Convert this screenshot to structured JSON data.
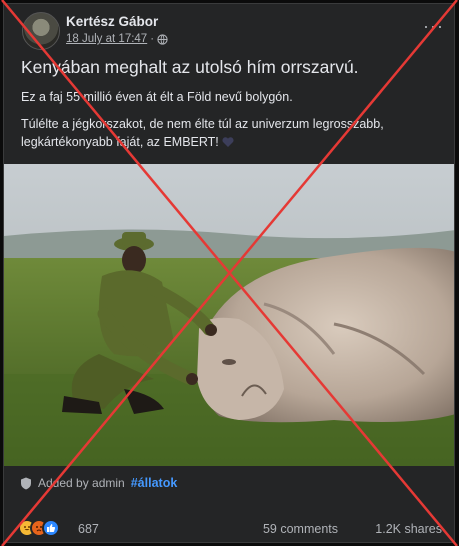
{
  "post": {
    "author": "Kertész Gábor",
    "date": "18 July at 17:47",
    "separator": "·",
    "headline": "Kenyában meghalt az utolsó hím orrszarvú.",
    "paragraph1": "Ez a faj 55 millió éven át élt a Föld nevű bolygón.",
    "paragraph2": "Túlélte a jégkorszakot, de nem élte túl az univerzum legrosszabb, legkártékonyabb faját, az EMBERT!",
    "image_icon": "black-heart-emoji"
  },
  "footer": {
    "added_by": "Added by admin",
    "tag": "#állatok"
  },
  "stats": {
    "reaction_count": "687",
    "comments": "59 comments",
    "shares": "1.2K shares"
  },
  "colors": {
    "card_bg": "#242526",
    "link": "#4599ff",
    "cross": "#e53935"
  }
}
